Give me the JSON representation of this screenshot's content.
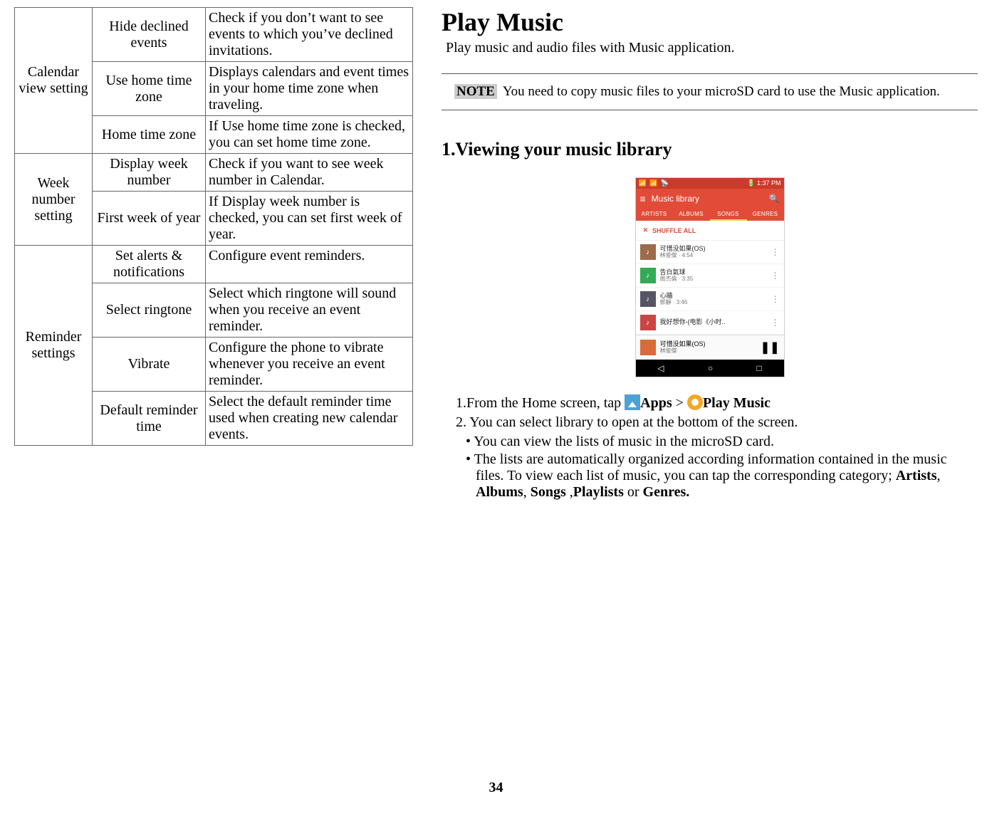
{
  "table": {
    "groups": [
      {
        "category": "Calendar view setting",
        "rows": [
          {
            "name": "Hide declined events",
            "desc": "Check if you don’t want to see events to which you’ve declined invitations."
          },
          {
            "name": "Use home time zone",
            "desc": "Displays calendars and event times in your home time zone when traveling."
          },
          {
            "name": "Home time zone",
            "desc": "If Use home time zone is checked, you can set home time zone."
          }
        ]
      },
      {
        "category": "Week number setting",
        "rows": [
          {
            "name": "Display week number",
            "desc": "Check if you want to see week number in Calendar."
          },
          {
            "name": "First week of year",
            "desc": "If Display week number is checked, you can set first week of year."
          }
        ]
      },
      {
        "category": "Reminder settings",
        "rows": [
          {
            "name": "Set alerts & notifications",
            "desc": "Configure event reminders."
          },
          {
            "name": "Select ringtone",
            "desc": "Select which ringtone will sound when you receive an event reminder."
          },
          {
            "name": "Vibrate",
            "desc": "Configure the phone to vibrate whenever you receive an event reminder."
          },
          {
            "name": "Default reminder time",
            "desc": "Select the default reminder time used when creating new calendar events."
          }
        ]
      }
    ]
  },
  "right": {
    "title": "Play Music",
    "intro": "Play music and audio files with Music application.",
    "note_label": "NOTE",
    "note_text": "You need to copy music files to your microSD card to use the Music application.",
    "subhead": "1.Viewing your music library",
    "step1_pre": "1.From the Home screen, tap  ",
    "step1_apps": "Apps",
    "step1_gt": " > ",
    "step1_play": "Play Music",
    "step2": "2. You can select library to open at the bottom of the screen.",
    "bullet1": "• You can view the lists of music in the microSD card.",
    "bullet2a": "• The lists are automatically organized according information contained in the music files. To view each list of music, you can tap the corresponding category; ",
    "b_artists": "Artists",
    "b_albums": "Albums",
    "b_songs": "Songs",
    "b_playlists": "Playlists",
    "b_genres": "Genres.",
    "comma": ", ",
    "space_comma": " ,",
    "or": " or "
  },
  "phone": {
    "time": "1:37 PM",
    "appbar_title": "Music library",
    "tabs": [
      "ARTISTS",
      "ALBUMS",
      "SONGS",
      "GENRES"
    ],
    "shuffle": "SHUFFLE ALL",
    "songs": [
      {
        "title": "可惜没如果(OS)",
        "sub": "林俊傑 · 4:54"
      },
      {
        "title": "告白氣球",
        "sub": "周杰倫 · 3:35"
      },
      {
        "title": "心牆",
        "sub": "郭靜 · 3:46"
      },
      {
        "title": "我好想你-(电影《小时..",
        "sub": ""
      }
    ],
    "now": {
      "title": "可惜没如果(OS)",
      "sub": "林俊傑"
    }
  },
  "page_number": "34"
}
